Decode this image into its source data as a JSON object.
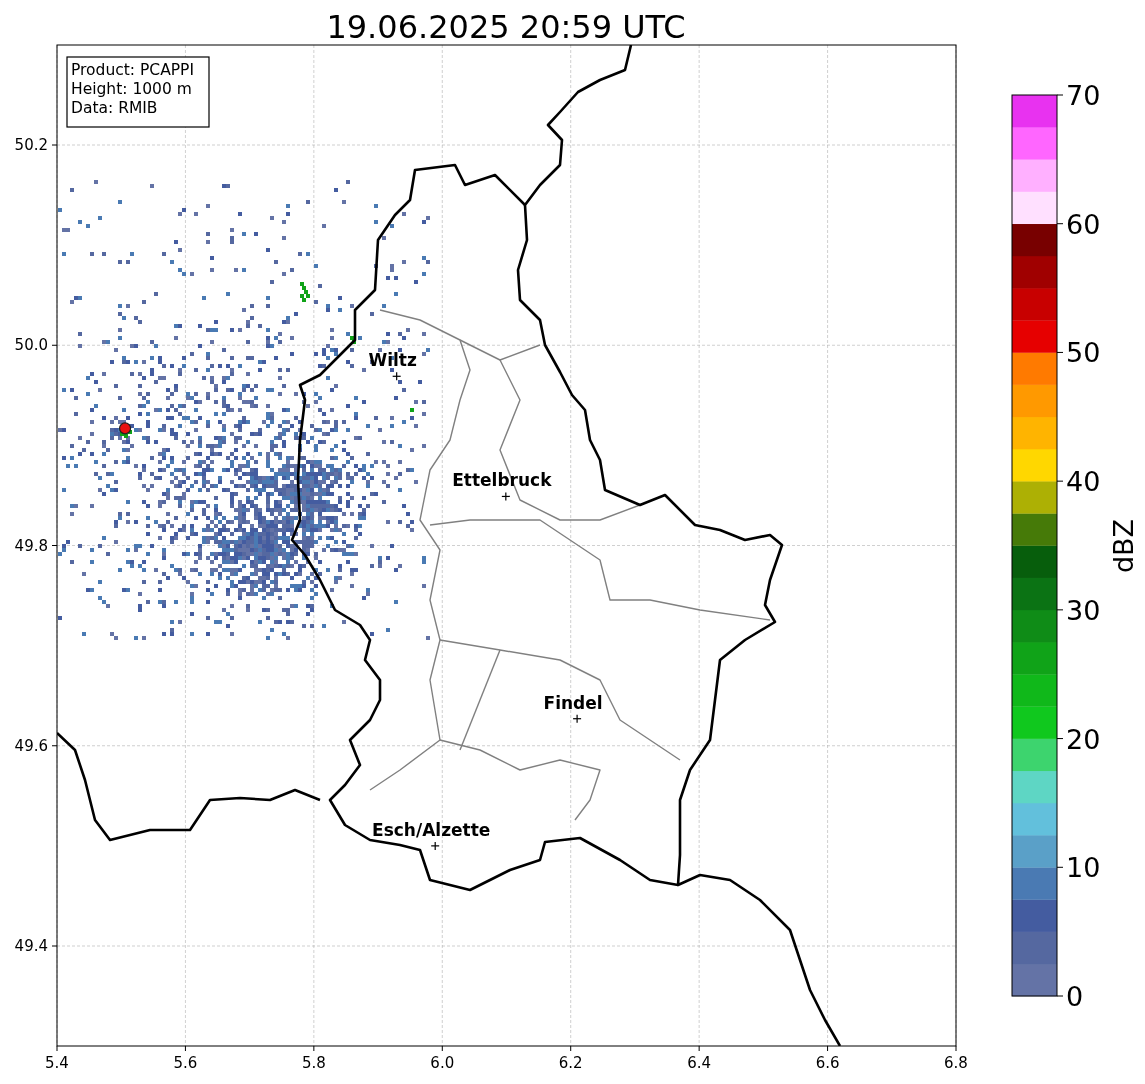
{
  "title": "19.06.2025 20:59 UTC",
  "info_box": [
    "Product: PCAPPI",
    "Height: 1000 m",
    "Data: RMIB"
  ],
  "map": {
    "xticks": [
      "5.4",
      "5.6",
      "5.8",
      "6.0",
      "6.2",
      "6.4",
      "6.6",
      "6.8"
    ],
    "yticks": [
      "50.2",
      "50.0",
      "49.8",
      "49.6",
      "49.4"
    ],
    "cities": [
      {
        "name": "Wiltz"
      },
      {
        "name": "Ettelbruck"
      },
      {
        "name": "Findel"
      },
      {
        "name": "Esch/Alzette"
      }
    ]
  },
  "colorbar": {
    "label": "dBZ",
    "ticks": [
      "70",
      "60",
      "50",
      "40",
      "30",
      "20",
      "10",
      "0"
    ],
    "bins": [
      {
        "color": "#6473a6"
      },
      {
        "color": "#5568a0"
      },
      {
        "color": "#445ca0"
      },
      {
        "color": "#4a7ab3"
      },
      {
        "color": "#5aa0c8"
      },
      {
        "color": "#62c0dc"
      },
      {
        "color": "#5ed6c4"
      },
      {
        "color": "#3dd46e"
      },
      {
        "color": "#10c81e"
      },
      {
        "color": "#10b81a"
      },
      {
        "color": "#10a318"
      },
      {
        "color": "#0f8c17"
      },
      {
        "color": "#0b7314"
      },
      {
        "color": "#075e0c"
      },
      {
        "color": "#467a08"
      },
      {
        "color": "#adb004"
      },
      {
        "color": "#ffd700"
      },
      {
        "color": "#ffb400"
      },
      {
        "color": "#ff9900"
      },
      {
        "color": "#ff7a00"
      },
      {
        "color": "#e60000"
      },
      {
        "color": "#c80000"
      },
      {
        "color": "#a00000"
      },
      {
        "color": "#780000"
      },
      {
        "color": "#ffe0ff"
      },
      {
        "color": "#ffb0ff"
      },
      {
        "color": "#ff66ff"
      },
      {
        "color": "#e832f0"
      }
    ]
  }
}
